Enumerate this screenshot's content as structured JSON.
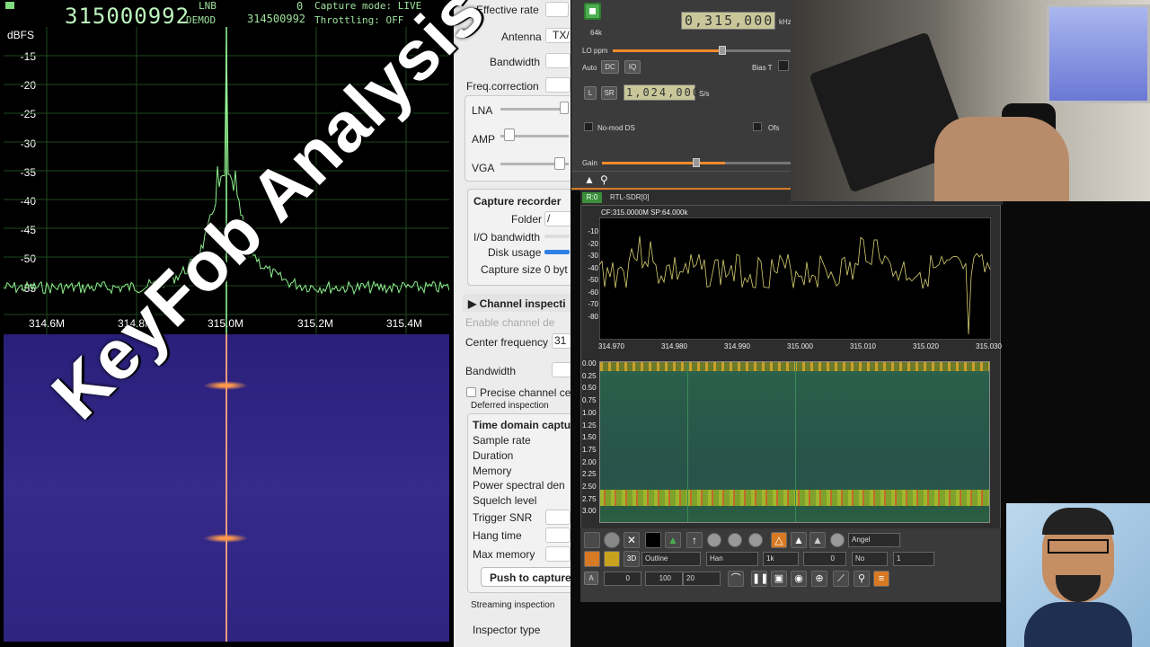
{
  "left_panel": {
    "frequency": "315000992",
    "lnb_label": "LNB",
    "lnb_value": "0",
    "demod_label": "DEMOD",
    "demod_value": "314500992",
    "capture_mode": "Capture mode: LIVE",
    "throttling": "Throttling: OFF",
    "y_axis_label": "dBFS",
    "y_ticks": [
      "-15",
      "-20",
      "-25",
      "-30",
      "-35",
      "-40",
      "-45",
      "-50",
      "-55"
    ],
    "x_ticks": [
      "314.6M",
      "314.8M",
      "315.0M",
      "315.2M",
      "315.4M"
    ]
  },
  "settings": {
    "effective_rate": "Effective rate",
    "antenna": "Antenna",
    "antenna_value": "TX/",
    "bandwidth": "Bandwidth",
    "freq_correction": "Freq.correction",
    "lna": "LNA",
    "amp": "AMP",
    "vga": "VGA",
    "capture_recorder": "Capture recorder",
    "folder": "Folder",
    "folder_value": "/",
    "io_bandwidth": "I/O bandwidth",
    "disk_usage": "Disk usage",
    "capture_size": "Capture size 0 byt",
    "channel_inspection": "▶ Channel inspecti",
    "enable_channel": "Enable channel de",
    "center_frequency": "Center frequency",
    "center_frequency_value": "31",
    "bandwidth2": "Bandwidth",
    "precise_channel": "Precise channel ce",
    "deferred_inspection": "Deferred inspection",
    "time_domain": "Time domain captu",
    "sample_rate": "Sample rate",
    "duration": "Duration",
    "memory": "Memory",
    "power_spectral": "Power spectral den",
    "squelch": "Squelch level",
    "trigger_snr": "Trigger SNR",
    "hang_time": "Hang time",
    "max_memory": "Max memory",
    "push_capture": "Push to capture",
    "streaming_inspection": "Streaming inspection",
    "inspector_type": "Inspector type"
  },
  "sdr": {
    "freq_display": "0,315,000",
    "freq_unit": "kHz",
    "rate_64k": "64k",
    "lo_ppm": "LO ppm",
    "auto": "Auto",
    "dc": "DC",
    "iq": "IQ",
    "bias_t": "Bias T",
    "l": "L",
    "sr": "SR",
    "sample_rate": "1,024,000",
    "sample_unit": "S/s",
    "no_mod_ds": "No-mod DS",
    "ofs": "Ofs",
    "gain": "Gain",
    "device_index": "R:0",
    "device_name": "RTL-SDR[0]",
    "plot_info": "CF:315.0000M SP:64.000k",
    "y_ticks": [
      "-10",
      "-20",
      "-30",
      "-40",
      "-50",
      "-60",
      "-70",
      "-80"
    ],
    "x_ticks": [
      "314.970",
      "314.980",
      "314.990",
      "315.000",
      "315.010",
      "315.020",
      "315.030"
    ],
    "wf_ticks": [
      "0.00",
      "0.25",
      "0.50",
      "0.75",
      "1.00",
      "1.25",
      "1.50",
      "1.75",
      "2.00",
      "2.25",
      "2.50",
      "2.75",
      "3.00"
    ],
    "combo_angel": "Angel",
    "combo_outline": "Outline",
    "combo_han": "Han",
    "combo_1k": "1k",
    "combo_0": "0",
    "combo_no": "No",
    "combo_1": "1",
    "combo_a_0": "0",
    "combo_100": "100",
    "combo_20": "20",
    "btn_a": "A"
  },
  "overlay_title": "KeyFob Analysis"
}
